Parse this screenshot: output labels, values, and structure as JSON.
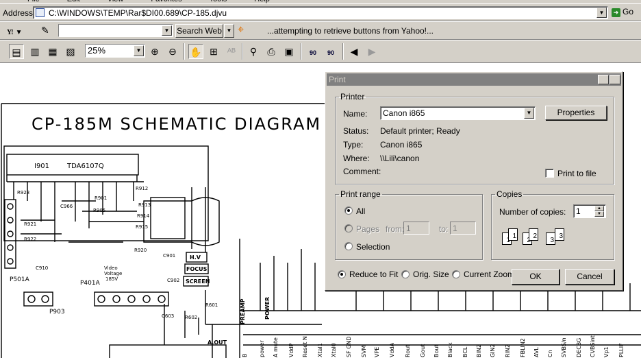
{
  "menubar": {
    "items": [
      "File",
      "Edit",
      "View",
      "Favorites",
      "Tools",
      "Help"
    ]
  },
  "address": {
    "label": "Address",
    "value": "C:\\WINDOWS\\TEMP\\Rar$DI00.689\\CP-185.djvu",
    "go_label": "Go"
  },
  "yahoo": {
    "logo": "Y!",
    "search_button": "Search Web",
    "message": "...attempting to retrieve buttons from Yahoo!..."
  },
  "djvu_toolbar": {
    "zoom_value": "25%",
    "rotate_left_label": "90",
    "rotate_right_label": "90"
  },
  "document": {
    "title": "CP-185M SCHEMATIC DIAGRAM"
  },
  "print_dialog": {
    "title": "Print",
    "help_btn": "?",
    "close_btn": "X",
    "printer_group": "Printer",
    "name_label": "Name:",
    "printer_name": "Canon i865",
    "properties_btn": "Properties",
    "status_label": "Status:",
    "status_value": "Default printer; Ready",
    "type_label": "Type:",
    "type_value": "Canon i865",
    "where_label": "Where:",
    "where_value": "\\\\Lili\\canon",
    "comment_label": "Comment:",
    "print_to_file": "Print to file",
    "range_group": "Print range",
    "range_all": "All",
    "range_pages": "Pages",
    "from_label": "from:",
    "from_value": "1",
    "to_label": "to:",
    "to_value": "1",
    "range_selection": "Selection",
    "copies_group": "Copies",
    "copies_label": "Number of copies:",
    "copies_value": "1",
    "collate_pages": [
      "1",
      "1",
      "2",
      "2",
      "3",
      "3"
    ],
    "reduce_to_fit": "Reduce to Fit",
    "orig_size": "Orig. Size",
    "current_zoom": "Current Zoom",
    "ok_btn": "OK",
    "cancel_btn": "Cancel"
  }
}
